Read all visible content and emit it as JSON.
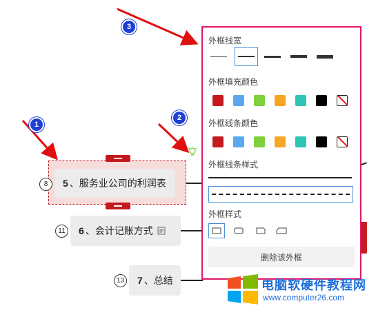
{
  "nodes": [
    {
      "index": "8",
      "number": "5",
      "text": "、服务业公司的利润表"
    },
    {
      "index": "11",
      "number": "6",
      "text": "、会计记账方式"
    },
    {
      "index": "13",
      "number": "7",
      "text": "、总结"
    }
  ],
  "badges": [
    "1",
    "2",
    "3"
  ],
  "panel": {
    "border_width_title": "外框线宽",
    "fill_color_title": "外框填充颜色",
    "line_color_title": "外框线条颜色",
    "line_style_title": "外框线条样式",
    "shape_title": "外框样式",
    "remove_label": "删除该外框",
    "fill_colors": [
      "#c41a1f",
      "#5aa9f0",
      "#7ed13c",
      "#f5a623",
      "#2ec4b6",
      "#000000"
    ],
    "line_colors": [
      "#c41a1f",
      "#5aa9f0",
      "#7ed13c",
      "#f5a623",
      "#2ec4b6",
      "#000000"
    ]
  },
  "watermark": {
    "title": "电脑软硬件教程网",
    "url": "www.computer26.com"
  },
  "colors": {
    "accent": "#e0176a",
    "selection": "#c41a1f",
    "badge": "#1f3fd6"
  }
}
